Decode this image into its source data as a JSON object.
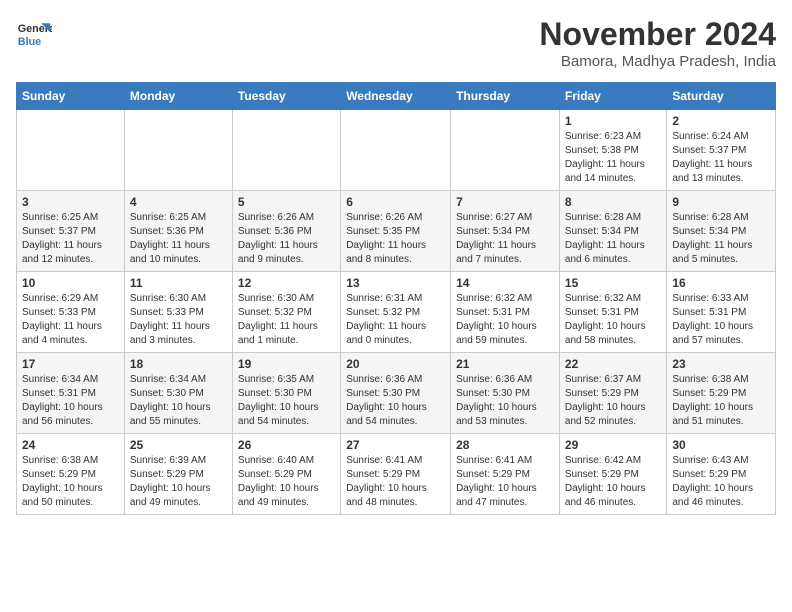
{
  "header": {
    "logo_line1": "General",
    "logo_line2": "Blue",
    "title": "November 2024",
    "subtitle": "Bamora, Madhya Pradesh, India"
  },
  "days_of_week": [
    "Sunday",
    "Monday",
    "Tuesday",
    "Wednesday",
    "Thursday",
    "Friday",
    "Saturday"
  ],
  "weeks": [
    [
      {
        "day": "",
        "info": ""
      },
      {
        "day": "",
        "info": ""
      },
      {
        "day": "",
        "info": ""
      },
      {
        "day": "",
        "info": ""
      },
      {
        "day": "",
        "info": ""
      },
      {
        "day": "1",
        "info": "Sunrise: 6:23 AM\nSunset: 5:38 PM\nDaylight: 11 hours and 14 minutes."
      },
      {
        "day": "2",
        "info": "Sunrise: 6:24 AM\nSunset: 5:37 PM\nDaylight: 11 hours and 13 minutes."
      }
    ],
    [
      {
        "day": "3",
        "info": "Sunrise: 6:25 AM\nSunset: 5:37 PM\nDaylight: 11 hours and 12 minutes."
      },
      {
        "day": "4",
        "info": "Sunrise: 6:25 AM\nSunset: 5:36 PM\nDaylight: 11 hours and 10 minutes."
      },
      {
        "day": "5",
        "info": "Sunrise: 6:26 AM\nSunset: 5:36 PM\nDaylight: 11 hours and 9 minutes."
      },
      {
        "day": "6",
        "info": "Sunrise: 6:26 AM\nSunset: 5:35 PM\nDaylight: 11 hours and 8 minutes."
      },
      {
        "day": "7",
        "info": "Sunrise: 6:27 AM\nSunset: 5:34 PM\nDaylight: 11 hours and 7 minutes."
      },
      {
        "day": "8",
        "info": "Sunrise: 6:28 AM\nSunset: 5:34 PM\nDaylight: 11 hours and 6 minutes."
      },
      {
        "day": "9",
        "info": "Sunrise: 6:28 AM\nSunset: 5:34 PM\nDaylight: 11 hours and 5 minutes."
      }
    ],
    [
      {
        "day": "10",
        "info": "Sunrise: 6:29 AM\nSunset: 5:33 PM\nDaylight: 11 hours and 4 minutes."
      },
      {
        "day": "11",
        "info": "Sunrise: 6:30 AM\nSunset: 5:33 PM\nDaylight: 11 hours and 3 minutes."
      },
      {
        "day": "12",
        "info": "Sunrise: 6:30 AM\nSunset: 5:32 PM\nDaylight: 11 hours and 1 minute."
      },
      {
        "day": "13",
        "info": "Sunrise: 6:31 AM\nSunset: 5:32 PM\nDaylight: 11 hours and 0 minutes."
      },
      {
        "day": "14",
        "info": "Sunrise: 6:32 AM\nSunset: 5:31 PM\nDaylight: 10 hours and 59 minutes."
      },
      {
        "day": "15",
        "info": "Sunrise: 6:32 AM\nSunset: 5:31 PM\nDaylight: 10 hours and 58 minutes."
      },
      {
        "day": "16",
        "info": "Sunrise: 6:33 AM\nSunset: 5:31 PM\nDaylight: 10 hours and 57 minutes."
      }
    ],
    [
      {
        "day": "17",
        "info": "Sunrise: 6:34 AM\nSunset: 5:31 PM\nDaylight: 10 hours and 56 minutes."
      },
      {
        "day": "18",
        "info": "Sunrise: 6:34 AM\nSunset: 5:30 PM\nDaylight: 10 hours and 55 minutes."
      },
      {
        "day": "19",
        "info": "Sunrise: 6:35 AM\nSunset: 5:30 PM\nDaylight: 10 hours and 54 minutes."
      },
      {
        "day": "20",
        "info": "Sunrise: 6:36 AM\nSunset: 5:30 PM\nDaylight: 10 hours and 54 minutes."
      },
      {
        "day": "21",
        "info": "Sunrise: 6:36 AM\nSunset: 5:30 PM\nDaylight: 10 hours and 53 minutes."
      },
      {
        "day": "22",
        "info": "Sunrise: 6:37 AM\nSunset: 5:29 PM\nDaylight: 10 hours and 52 minutes."
      },
      {
        "day": "23",
        "info": "Sunrise: 6:38 AM\nSunset: 5:29 PM\nDaylight: 10 hours and 51 minutes."
      }
    ],
    [
      {
        "day": "24",
        "info": "Sunrise: 6:38 AM\nSunset: 5:29 PM\nDaylight: 10 hours and 50 minutes."
      },
      {
        "day": "25",
        "info": "Sunrise: 6:39 AM\nSunset: 5:29 PM\nDaylight: 10 hours and 49 minutes."
      },
      {
        "day": "26",
        "info": "Sunrise: 6:40 AM\nSunset: 5:29 PM\nDaylight: 10 hours and 49 minutes."
      },
      {
        "day": "27",
        "info": "Sunrise: 6:41 AM\nSunset: 5:29 PM\nDaylight: 10 hours and 48 minutes."
      },
      {
        "day": "28",
        "info": "Sunrise: 6:41 AM\nSunset: 5:29 PM\nDaylight: 10 hours and 47 minutes."
      },
      {
        "day": "29",
        "info": "Sunrise: 6:42 AM\nSunset: 5:29 PM\nDaylight: 10 hours and 46 minutes."
      },
      {
        "day": "30",
        "info": "Sunrise: 6:43 AM\nSunset: 5:29 PM\nDaylight: 10 hours and 46 minutes."
      }
    ]
  ]
}
